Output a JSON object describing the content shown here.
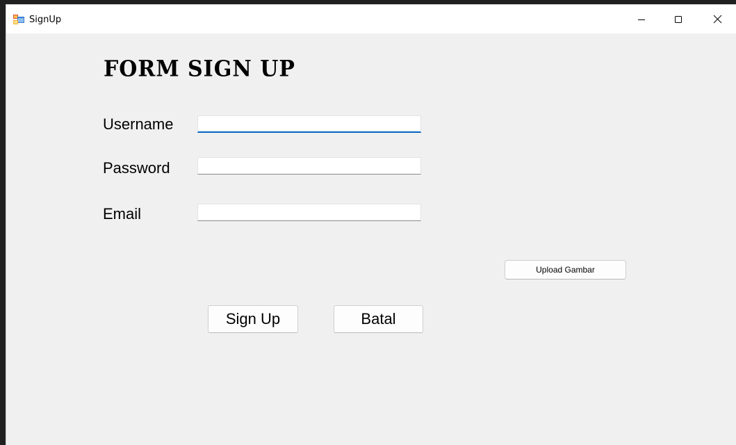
{
  "window": {
    "title": "SignUp",
    "controls": {
      "minimize": "minimize-icon",
      "maximize": "maximize-icon",
      "close": "close-icon"
    }
  },
  "form": {
    "title": "FORM SIGN UP",
    "fields": {
      "username": {
        "label": "Username",
        "value": ""
      },
      "password": {
        "label": "Password",
        "value": ""
      },
      "email": {
        "label": "Email",
        "value": ""
      }
    },
    "upload_button": "Upload Gambar",
    "signup_button": "Sign Up",
    "cancel_button": "Batal"
  },
  "colors": {
    "window_bg": "#f0f0f0",
    "titlebar_bg": "#ffffff",
    "focus_accent": "#0067c0"
  }
}
